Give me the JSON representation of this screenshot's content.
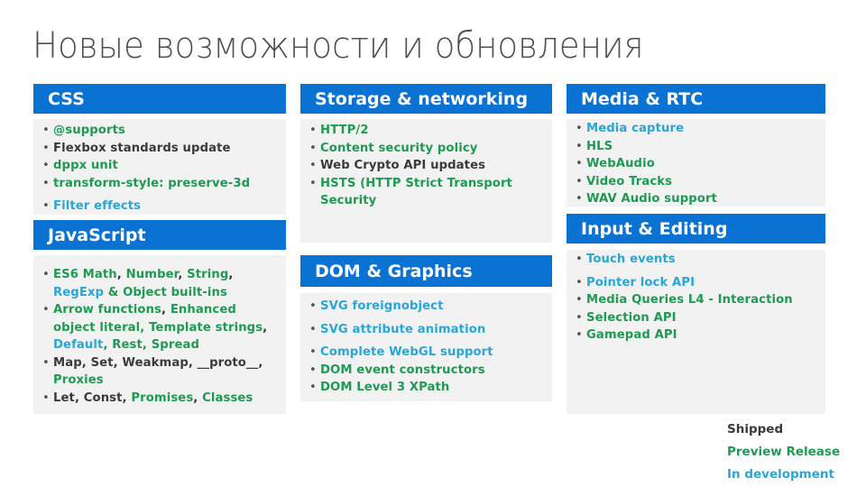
{
  "title": "Новые возможности и обновления",
  "colors": {
    "header_bg": "#0a72d3",
    "panel_bg": "#f2f2f2",
    "shipped": "#3a3a3a",
    "preview": "#1f9a52",
    "dev": "#2aa6d6"
  },
  "panels": {
    "css": {
      "title": "CSS",
      "items": [
        {
          "parts": [
            {
              "text": "@supports",
              "status": "preview"
            }
          ]
        },
        {
          "parts": [
            {
              "text": "Flexbox standards update",
              "status": "shipped"
            }
          ]
        },
        {
          "parts": [
            {
              "text": "dppx unit",
              "status": "preview"
            }
          ]
        },
        {
          "parts": [
            {
              "text": "transform-style: preserve-3d",
              "status": "preview"
            }
          ]
        },
        {
          "parts": [
            {
              "text": "Filter effects",
              "status": "dev"
            }
          ]
        }
      ]
    },
    "storage": {
      "title": "Storage & networking",
      "items": [
        {
          "parts": [
            {
              "text": "HTTP/2",
              "status": "preview"
            }
          ]
        },
        {
          "parts": [
            {
              "text": "Content security policy",
              "status": "preview"
            }
          ]
        },
        {
          "parts": [
            {
              "text": "Web Crypto API updates",
              "status": "shipped"
            }
          ]
        },
        {
          "parts": [
            {
              "text": "HSTS (HTTP Strict Transport Security",
              "status": "preview"
            }
          ]
        }
      ]
    },
    "media": {
      "title": "Media & RTC",
      "items": [
        {
          "parts": [
            {
              "text": "Media capture",
              "status": "dev"
            }
          ]
        },
        {
          "parts": [
            {
              "text": "HLS",
              "status": "preview"
            }
          ]
        },
        {
          "parts": [
            {
              "text": "WebAudio",
              "status": "preview"
            }
          ]
        },
        {
          "parts": [
            {
              "text": "Video Tracks",
              "status": "preview"
            }
          ]
        },
        {
          "parts": [
            {
              "text": "WAV Audio support",
              "status": "preview"
            }
          ]
        }
      ]
    },
    "javascript": {
      "title": "JavaScript",
      "items": [
        {
          "parts": [
            {
              "text": "ES6 Math",
              "status": "preview"
            },
            {
              "text": ", ",
              "status": "shipped"
            },
            {
              "text": "Number",
              "status": "preview"
            },
            {
              "text": ", ",
              "status": "shipped"
            },
            {
              "text": "String",
              "status": "preview"
            },
            {
              "text": ", ",
              "status": "shipped"
            },
            {
              "text": "RegExp",
              "status": "dev"
            },
            {
              "text": " & Object built-ins",
              "status": "preview"
            }
          ]
        },
        {
          "parts": [
            {
              "text": "Arrow functions",
              "status": "preview"
            },
            {
              "text": ", ",
              "status": "shipped"
            },
            {
              "text": "Enhanced object literal, Template strings",
              "status": "preview"
            },
            {
              "text": ", ",
              "status": "shipped"
            },
            {
              "text": "Default",
              "status": "dev"
            },
            {
              "text": ", Rest, Spread",
              "status": "preview"
            }
          ]
        },
        {
          "parts": [
            {
              "text": "Map, Set, Weakmap, __proto__, ",
              "status": "shipped"
            },
            {
              "text": "Proxies",
              "status": "preview"
            }
          ]
        },
        {
          "parts": [
            {
              "text": "Let, Const, ",
              "status": "shipped"
            },
            {
              "text": "Promises",
              "status": "preview"
            },
            {
              "text": ", ",
              "status": "shipped"
            },
            {
              "text": "Classes",
              "status": "preview"
            }
          ]
        }
      ]
    },
    "dom": {
      "title": "DOM & Graphics",
      "items": [
        {
          "parts": [
            {
              "text": "SVG foreignobject",
              "status": "dev"
            }
          ]
        },
        {
          "parts": [
            {
              "text": "SVG attribute animation",
              "status": "dev"
            }
          ],
          "gap": true
        },
        {
          "parts": [
            {
              "text": "Complete WebGL support",
              "status": "dev"
            }
          ],
          "gap": true
        },
        {
          "parts": [
            {
              "text": "DOM event constructors",
              "status": "preview"
            }
          ]
        },
        {
          "parts": [
            {
              "text": "DOM Level 3 XPath",
              "status": "preview"
            }
          ]
        }
      ]
    },
    "input": {
      "title": "Input & Editing",
      "items": [
        {
          "parts": [
            {
              "text": "Touch events",
              "status": "dev"
            }
          ]
        },
        {
          "parts": [
            {
              "text": "Pointer lock API",
              "status": "dev"
            }
          ],
          "gap": true
        },
        {
          "parts": [
            {
              "text": "Media Queries L4 - Interaction",
              "status": "preview"
            }
          ]
        },
        {
          "parts": [
            {
              "text": "Selection API",
              "status": "preview"
            }
          ]
        },
        {
          "parts": [
            {
              "text": "Gamepad API",
              "status": "preview"
            }
          ]
        }
      ]
    }
  },
  "legend": [
    {
      "label": "Shipped",
      "status": "shipped"
    },
    {
      "label": "Preview Release",
      "status": "preview"
    },
    {
      "label": "In development",
      "status": "dev"
    }
  ]
}
